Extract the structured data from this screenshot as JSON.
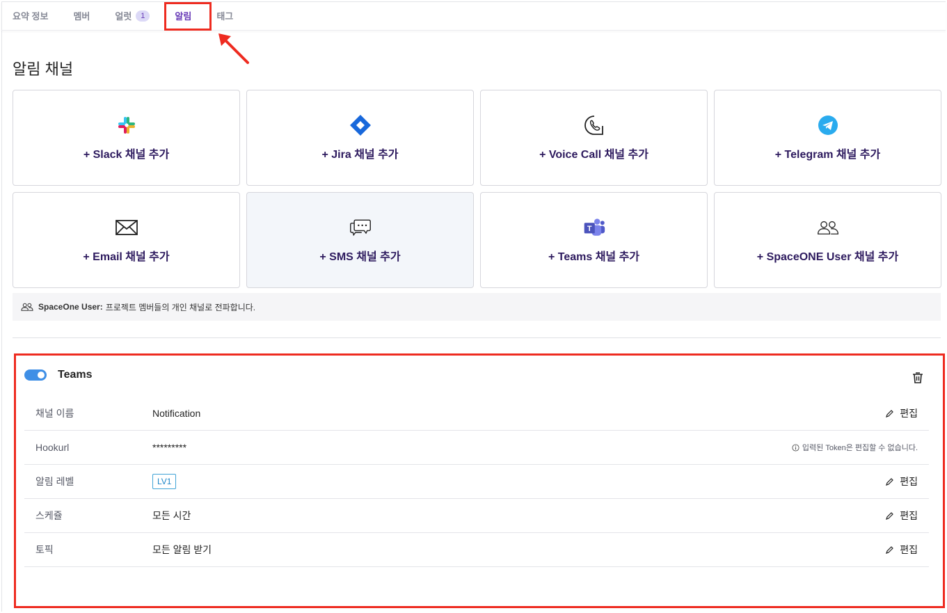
{
  "tabs": [
    {
      "label": "요약 정보"
    },
    {
      "label": "멤버"
    },
    {
      "label": "얼럿",
      "badge": "1"
    },
    {
      "label": "알림"
    },
    {
      "label": "태그"
    }
  ],
  "active_tab": "알림",
  "section_title": "알림 채널",
  "channels": [
    {
      "label": "+ Slack 채널 추가",
      "icon": "slack-icon"
    },
    {
      "label": "+ Jira 채널 추가",
      "icon": "jira-icon"
    },
    {
      "label": "+ Voice Call 채널 추가",
      "icon": "voice-call-icon"
    },
    {
      "label": "+ Telegram 채널 추가",
      "icon": "telegram-icon"
    },
    {
      "label": "+ Email 채널 추가",
      "icon": "email-icon"
    },
    {
      "label": "+ SMS 채널 추가",
      "icon": "sms-icon"
    },
    {
      "label": "+ Teams 채널 추가",
      "icon": "teams-icon"
    },
    {
      "label": "+ SpaceONE User 채널 추가",
      "icon": "users-icon"
    }
  ],
  "info_bar": {
    "title": "SpaceOne User:",
    "text": "프로젝트 멤버들의 개인 채널로 전파합니다."
  },
  "panel": {
    "name": "Teams",
    "enabled": true,
    "rows": [
      {
        "key": "채널 이름",
        "value": "Notification",
        "action": "편집"
      },
      {
        "key": "Hookurl",
        "value": "*********",
        "note": "입력된 Token은 편집할 수 없습니다."
      },
      {
        "key": "알림 레벨",
        "badge": "LV1",
        "action": "편집"
      },
      {
        "key": "스케쥴",
        "value": "모든 시간",
        "action": "편집"
      },
      {
        "key": "토픽",
        "value": "모든 알림 받기",
        "action": "편집"
      }
    ]
  },
  "colors": {
    "accent": "#6638b6",
    "card_label": "#2d1a5e",
    "toggle": "#3f8fe6",
    "highlight": "#ee2b20",
    "level_badge": "#1c86c8"
  }
}
